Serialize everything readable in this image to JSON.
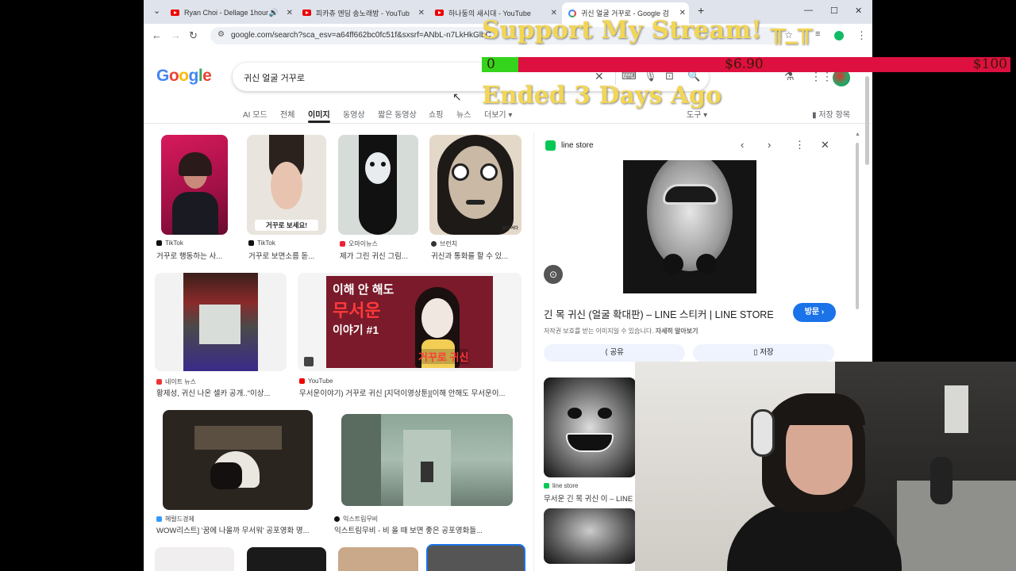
{
  "browser": {
    "tabs": [
      {
        "label": "Ryan Choi - Dellage 1hour"
      },
      {
        "label": "피카츄 엔딩 송노래방 - YouTub"
      },
      {
        "label": "하나둥의 새시대 - YouTube"
      },
      {
        "label": "귀신 얼굴 거꾸로 - Google 검"
      }
    ],
    "url": "google.com/search?sca_esv=a64ff662bc0fc51f&sxsrf=ANbL-n7LkHkGlbC"
  },
  "google": {
    "logo": "Google",
    "query": "귀신 얼굴 거꾸로",
    "nav_tabs": [
      "AI 모드",
      "전체",
      "이미지",
      "동영상",
      "짧은 동영상",
      "쇼핑",
      "뉴스",
      "더보기 ▾"
    ],
    "active_tab": "이미지",
    "tools": "도구 ▾",
    "saved": "저장 항목"
  },
  "results": [
    {
      "source": "TikTok",
      "title": "거꾸로 행동하는 사..."
    },
    {
      "source": "TikTok",
      "title": "거꾸로 보면소름 돋..."
    },
    {
      "source": "오마이뉴스",
      "title": "제가 그린 귀신 그림..."
    },
    {
      "source": "브런치",
      "title": "귀신과 통화를 할 수 있..."
    },
    {
      "source": "네이트 뉴스",
      "title": "황제성, 귀신 나온 셀카 공개..\"이상..."
    },
    {
      "source": "YouTube",
      "title": "무서운이야기) 거꾸로 귀신 [지덕이영상툰][이해 안해도 무서운이..."
    },
    {
      "source": "헤럴드경제",
      "title": "WOW리스트] '꿈에 나올까 무서워' 공포영화 명..."
    },
    {
      "source": "익스트림무비",
      "title": "익스트림무비 - 비 올 때 보면 좋은 공포영화들..."
    }
  ],
  "thumb_texts": {
    "t2_caption": "거꾸로 보세요!",
    "t4_caption": "보다 서다",
    "t6_line1": "이해 안 해도",
    "t6_line2": "무서운",
    "t6_line3": "이야기 #1",
    "t6_tag": "거꾸로 귀신"
  },
  "panel": {
    "source": "line store",
    "title": "긴 목 귀신 (얼굴 확대판) – LINE 스티커 | LINE STORE",
    "visit": "방문 ›",
    "copyright": "저작권 보호를 받는 이미지일 수 있습니다.",
    "learn_more": "자세히 알아보기",
    "share": "공유",
    "save": "저장",
    "related_source": "line store",
    "related_title": "무서운 긴 목 귀신 이 – LINE ..."
  },
  "overlay": {
    "support": "Support My Stream! ╥_╥",
    "ended": "Ended 3 Days Ago",
    "goal_current": 6.9,
    "goal_max": 100,
    "goal_start_label": "0",
    "goal_current_label": "$6.90",
    "goal_max_label": "$100"
  }
}
